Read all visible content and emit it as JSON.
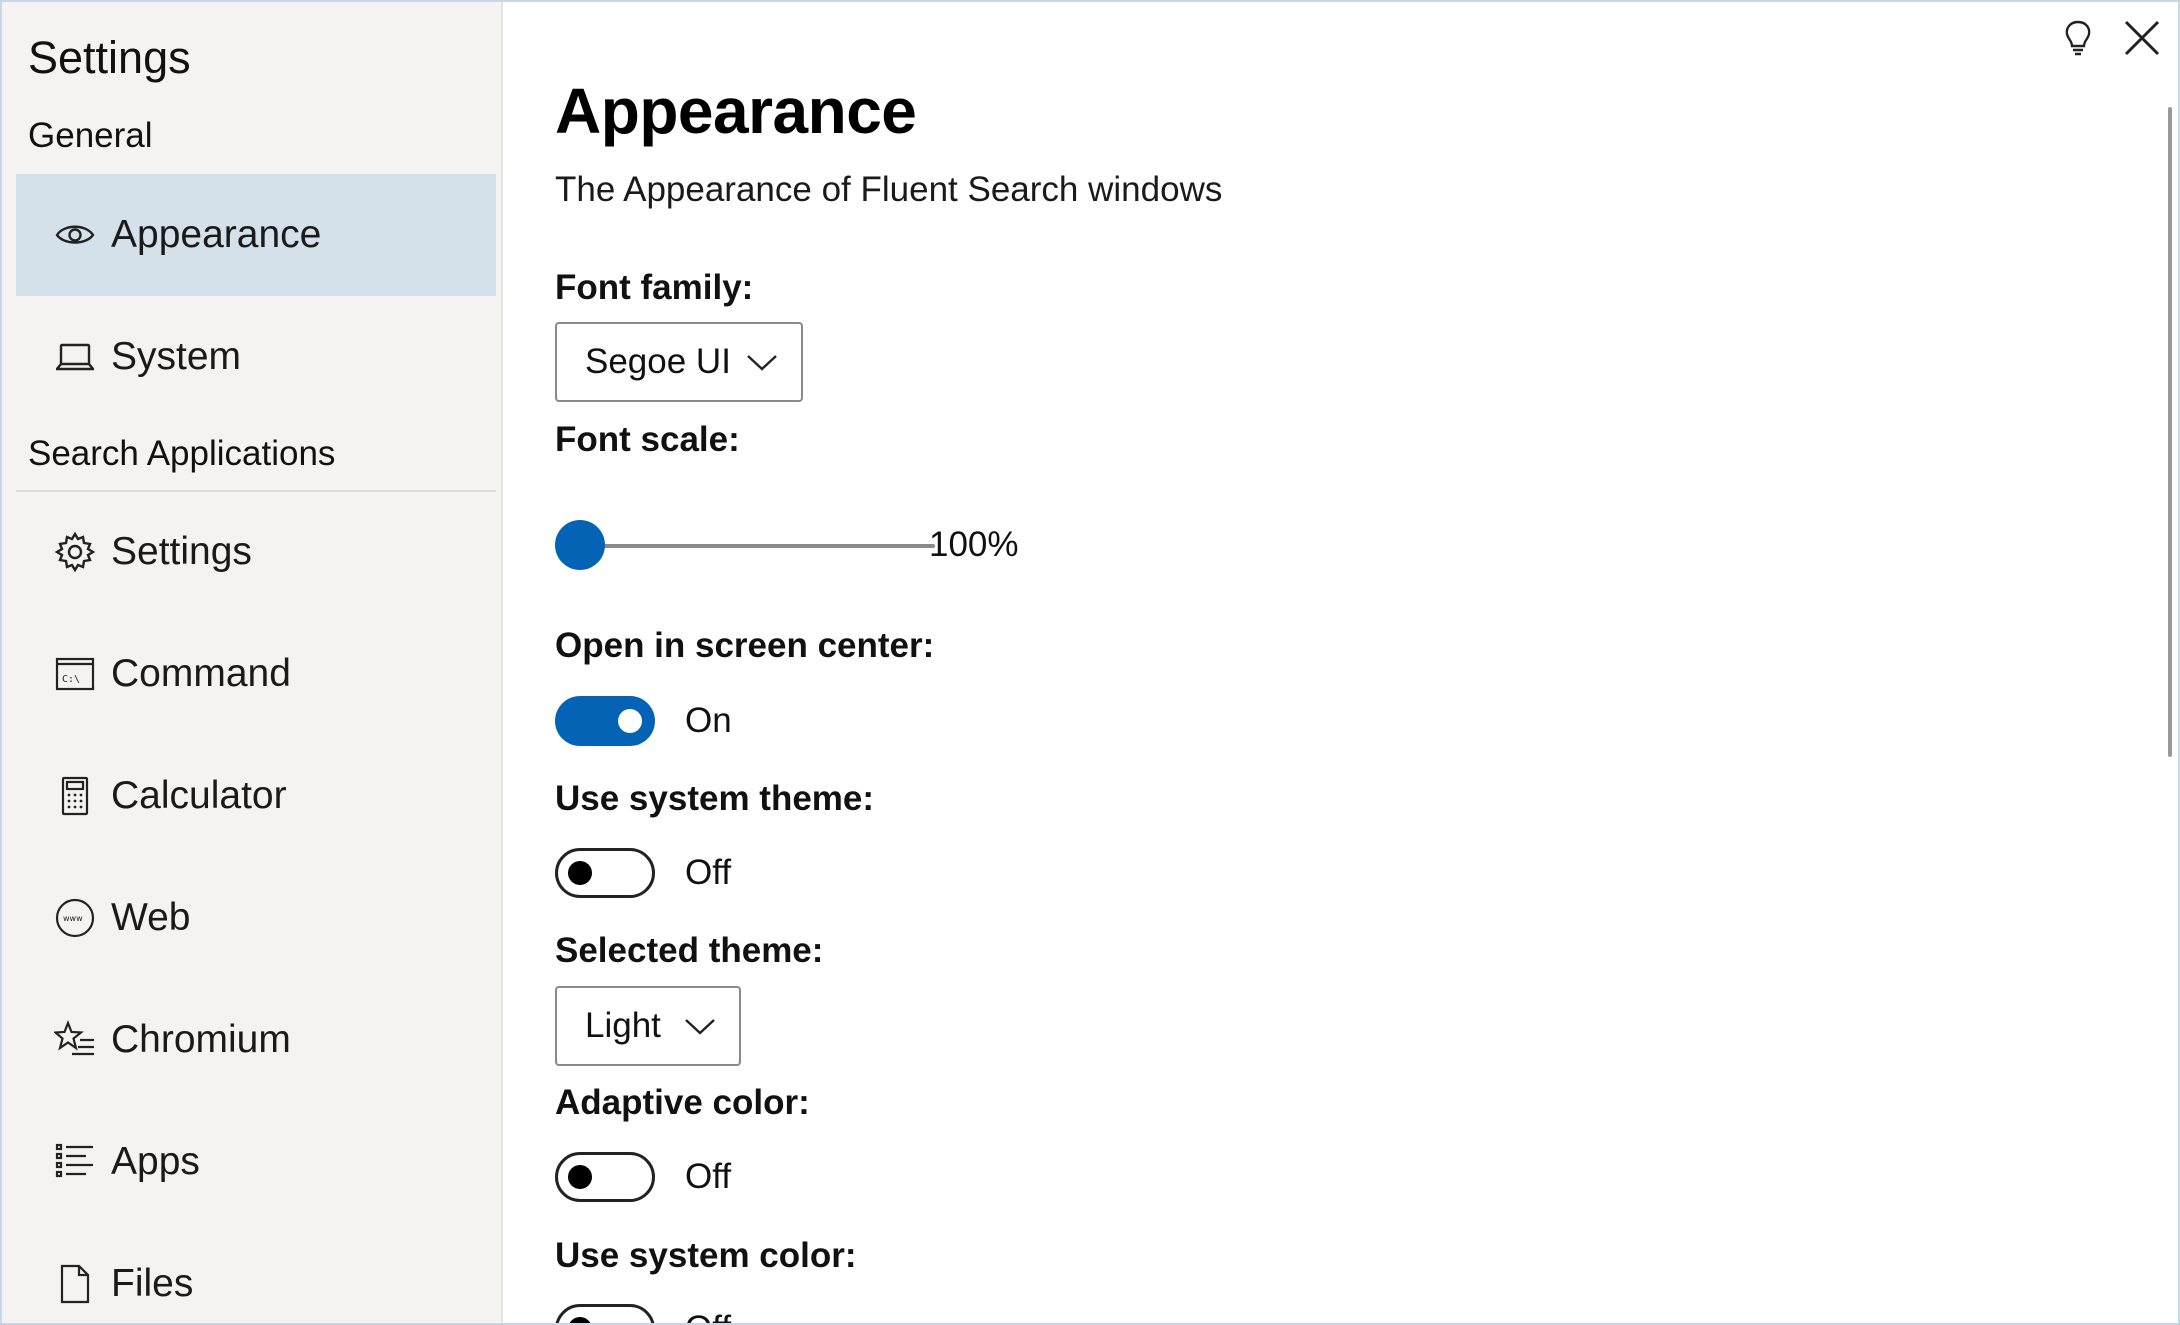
{
  "app": {
    "title": "Settings"
  },
  "sidebar": {
    "section_general": "General",
    "general_items": [
      {
        "label": "Appearance",
        "icon": "eye-icon",
        "selected": true
      },
      {
        "label": "System",
        "icon": "laptop-icon",
        "selected": false
      }
    ],
    "section_search": "Search Applications",
    "search_items": [
      {
        "label": "Settings",
        "icon": "gear-icon"
      },
      {
        "label": "Command",
        "icon": "command-prompt-icon"
      },
      {
        "label": "Calculator",
        "icon": "calculator-icon"
      },
      {
        "label": "Web",
        "icon": "web-icon"
      },
      {
        "label": "Chromium",
        "icon": "favorites-icon"
      },
      {
        "label": "Apps",
        "icon": "list-icon"
      },
      {
        "label": "Files",
        "icon": "file-icon"
      }
    ]
  },
  "main": {
    "title": "Appearance",
    "subtitle": "The Appearance of Fluent Search windows",
    "font_family": {
      "label": "Font family:",
      "value": "Segoe UI"
    },
    "font_scale": {
      "label": "Font scale:",
      "value": "100%",
      "fraction": 0.0
    },
    "open_center": {
      "label": "Open in screen center:",
      "state": "On"
    },
    "system_theme": {
      "label": "Use system theme:",
      "state": "Off"
    },
    "selected_theme": {
      "label": "Selected theme:",
      "value": "Light"
    },
    "adaptive_color": {
      "label": "Adaptive color:",
      "state": "Off"
    },
    "system_color": {
      "label": "Use system color:",
      "state": "Off"
    }
  },
  "colors": {
    "accent": "#0563b6",
    "selected_bg": "#d4e0ea",
    "sidebar_bg": "#f4f3f2"
  }
}
